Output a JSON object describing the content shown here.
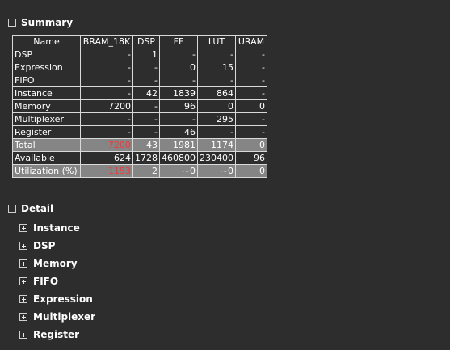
{
  "summary": {
    "title": "Summary",
    "columns": [
      "Name",
      "BRAM_18K",
      "DSP",
      "FF",
      "LUT",
      "URAM"
    ],
    "rows": [
      {
        "cells": [
          "DSP",
          "-",
          "1",
          "-",
          "-",
          "-"
        ],
        "highlight": false
      },
      {
        "cells": [
          "Expression",
          "-",
          "-",
          "0",
          "15",
          "-"
        ],
        "highlight": false
      },
      {
        "cells": [
          "FIFO",
          "-",
          "-",
          "-",
          "-",
          "-"
        ],
        "highlight": false
      },
      {
        "cells": [
          "Instance",
          "-",
          "42",
          "1839",
          "864",
          "-"
        ],
        "highlight": false
      },
      {
        "cells": [
          "Memory",
          "7200",
          "-",
          "96",
          "0",
          "0"
        ],
        "highlight": false
      },
      {
        "cells": [
          "Multiplexer",
          "-",
          "-",
          "-",
          "295",
          "-"
        ],
        "highlight": false
      },
      {
        "cells": [
          "Register",
          "-",
          "-",
          "46",
          "-",
          "-"
        ],
        "highlight": false
      },
      {
        "cells": [
          "Total",
          "7200",
          "43",
          "1981",
          "1174",
          "0"
        ],
        "highlight": true,
        "red_col": 1
      },
      {
        "cells": [
          "Available",
          "624",
          "1728",
          "460800",
          "230400",
          "96"
        ],
        "highlight": false
      },
      {
        "cells": [
          "Utilization (%)",
          "1153",
          "2",
          "~0",
          "~0",
          "0"
        ],
        "highlight": true,
        "red_col": 1
      }
    ]
  },
  "detail": {
    "title": "Detail",
    "items": [
      "Instance",
      "DSP",
      "Memory",
      "FIFO",
      "Expression",
      "Multiplexer",
      "Register"
    ]
  },
  "colors": {
    "background": "#2d2d2d",
    "highlight_row": "#858585",
    "over_utilization": "#ff3333"
  },
  "icons": {
    "expanded": "minus-box-icon",
    "collapsed": "plus-box-icon"
  }
}
